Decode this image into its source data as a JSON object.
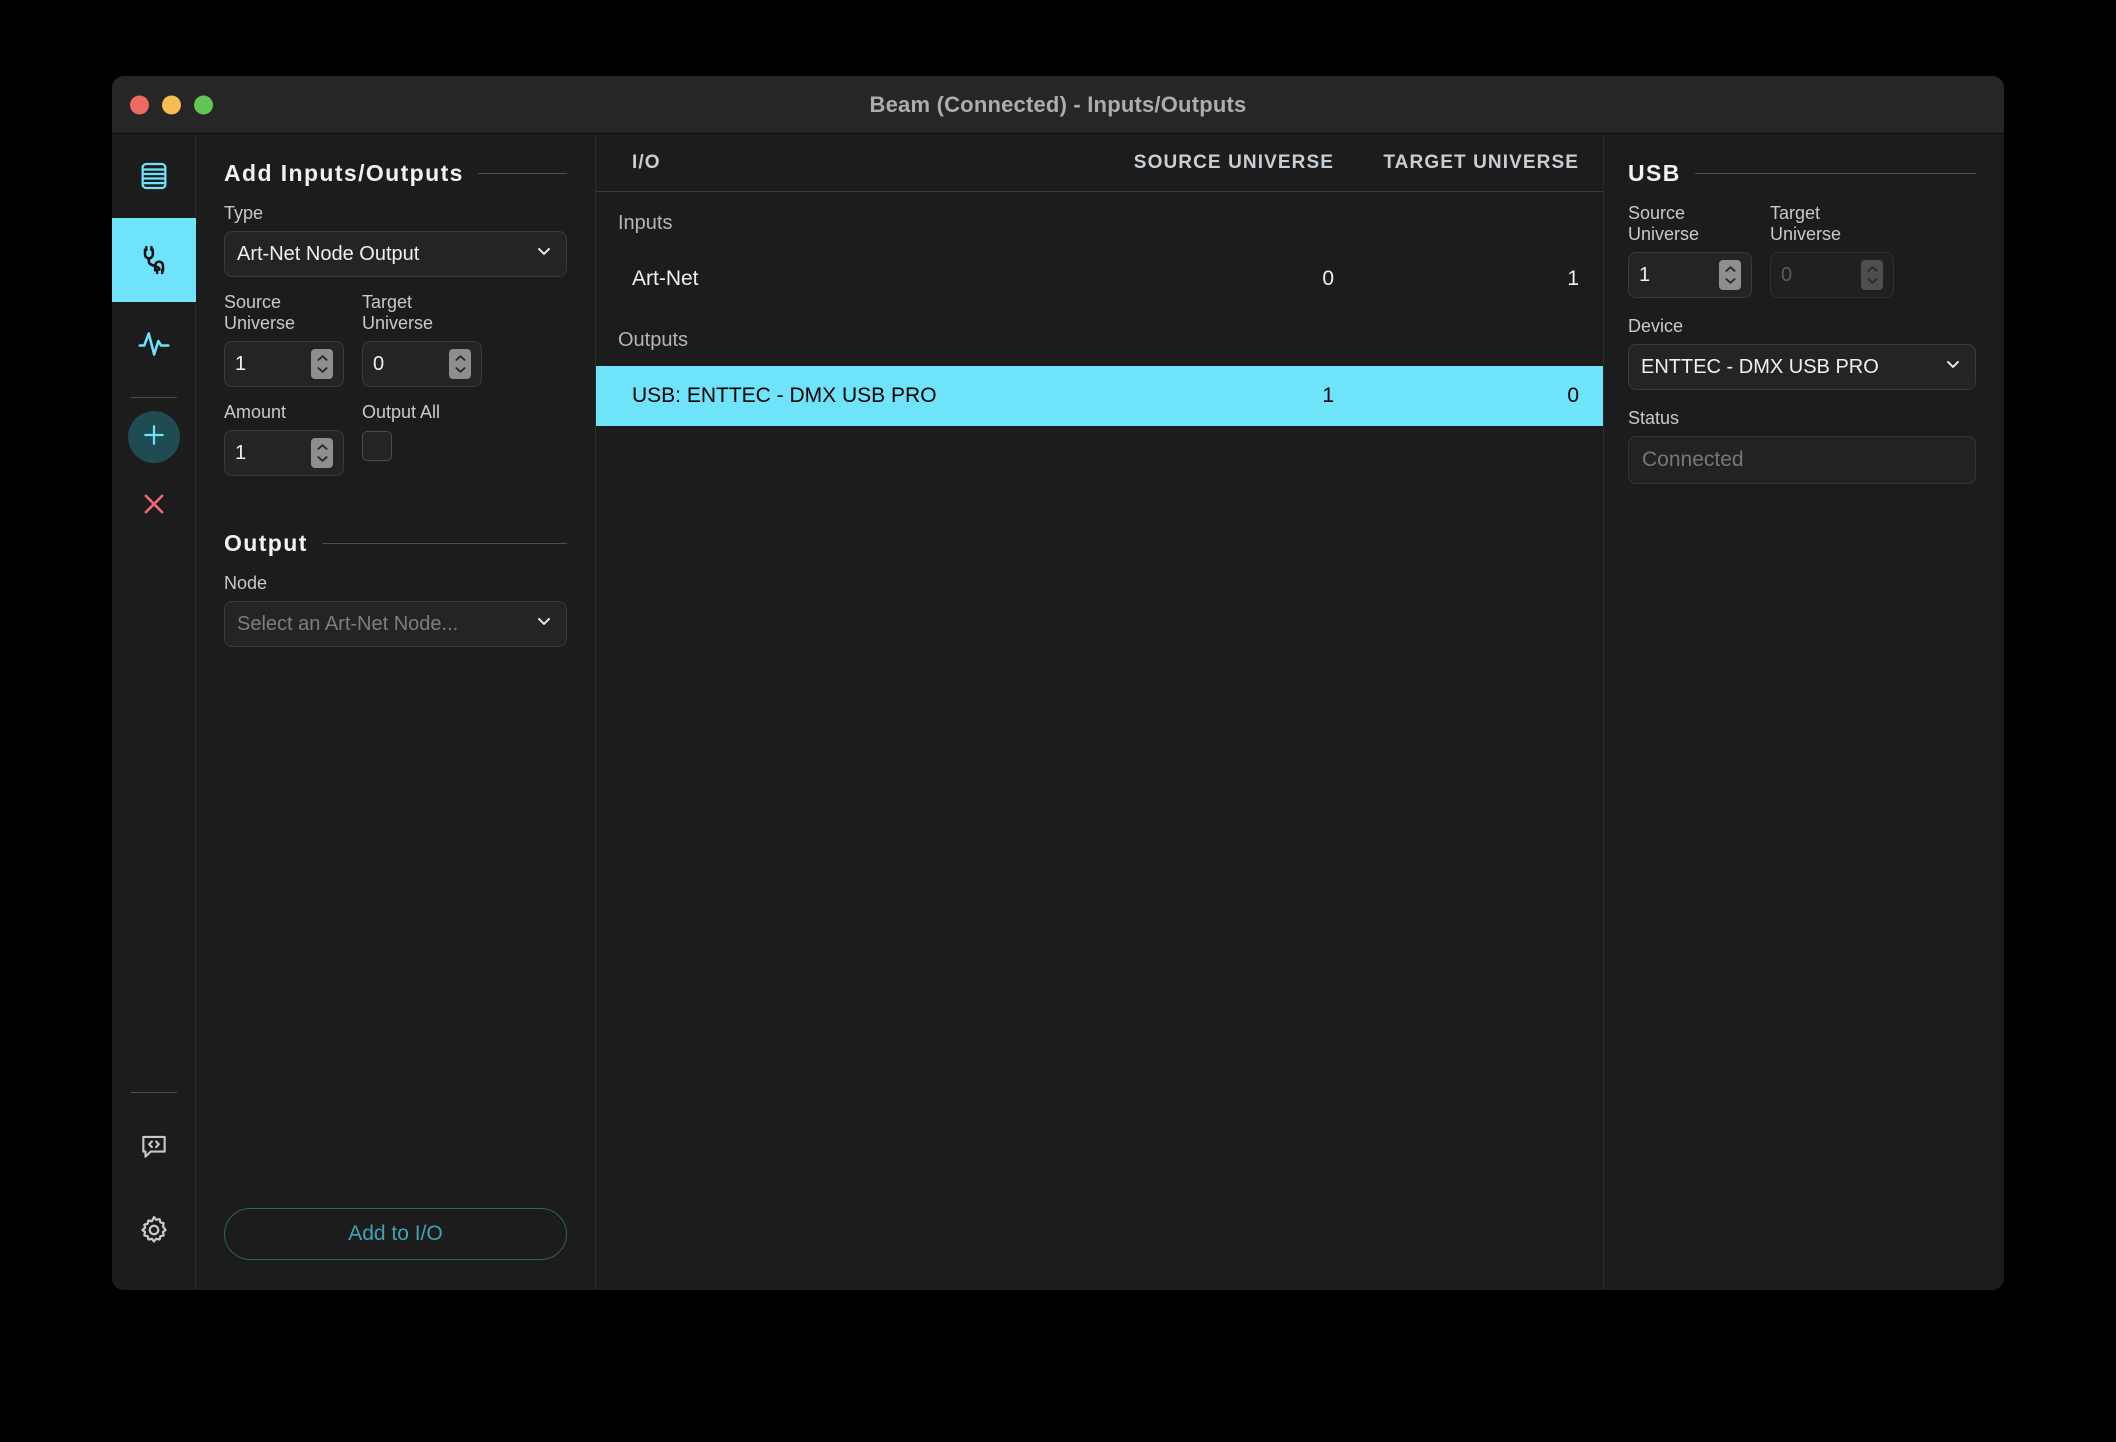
{
  "window": {
    "title": "Beam (Connected) - Inputs/Outputs",
    "accent_cyan": "#6FE3FA",
    "traffic_lights": [
      "close-button",
      "minimize-button",
      "maximize-button"
    ]
  },
  "rail": {
    "items": [
      {
        "name": "sidebar-item-patch",
        "icon": "list-panel-icon",
        "active": false
      },
      {
        "name": "sidebar-item-inputs-outputs",
        "icon": "plug-cable-icon",
        "active": true
      },
      {
        "name": "sidebar-item-monitor",
        "icon": "waveform-icon",
        "active": false
      }
    ],
    "add_button": {
      "name": "add-button",
      "icon": "plus-icon"
    },
    "remove_button": {
      "name": "remove-button",
      "icon": "close-x-icon"
    },
    "bottom_items": [
      {
        "name": "sidebar-item-console",
        "icon": "code-bubble-icon"
      },
      {
        "name": "sidebar-item-settings",
        "icon": "gear-icon"
      }
    ]
  },
  "left_panel": {
    "heading": "Add Inputs/Outputs",
    "type": {
      "label": "Type",
      "value": "Art-Net Node Output"
    },
    "source_universe": {
      "label": "Source Universe",
      "value": "1"
    },
    "target_universe": {
      "label": "Target Universe",
      "value": "0"
    },
    "amount": {
      "label": "Amount",
      "value": "1"
    },
    "output_all": {
      "label": "Output All",
      "checked": false
    },
    "output_section": {
      "heading": "Output",
      "node": {
        "label": "Node",
        "placeholder": "Select an Art-Net Node...",
        "value": ""
      }
    },
    "add_to_io_button": "Add to I/O"
  },
  "table": {
    "columns": [
      "I/O",
      "SOURCE UNIVERSE",
      "TARGET UNIVERSE"
    ],
    "groups": [
      {
        "label": "Inputs",
        "rows": [
          {
            "io": "Art-Net",
            "source_universe": "0",
            "target_universe": "1",
            "selected": false
          }
        ]
      },
      {
        "label": "Outputs",
        "rows": [
          {
            "io": "USB: ENTTEC - DMX USB PRO",
            "source_universe": "1",
            "target_universe": "0",
            "selected": true
          }
        ]
      }
    ]
  },
  "right_panel": {
    "heading": "USB",
    "source_universe": {
      "label": "Source Universe",
      "value": "1"
    },
    "target_universe": {
      "label": "Target Universe",
      "value": "0",
      "disabled": true
    },
    "device": {
      "label": "Device",
      "value": "ENTTEC - DMX USB PRO"
    },
    "status": {
      "label": "Status",
      "value": "Connected"
    }
  }
}
